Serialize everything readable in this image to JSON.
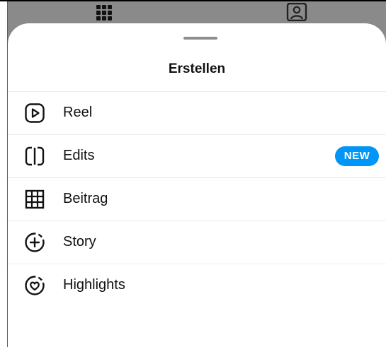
{
  "sheet": {
    "title": "Erstellen",
    "items": [
      {
        "label": "Reel",
        "icon": "reel-icon"
      },
      {
        "label": "Edits",
        "icon": "edits-icon",
        "badge": "NEW"
      },
      {
        "label": "Beitrag",
        "icon": "post-grid-icon"
      },
      {
        "label": "Story",
        "icon": "story-add-icon"
      },
      {
        "label": "Highlights",
        "icon": "highlights-heart-icon"
      }
    ]
  },
  "background": {
    "icons": [
      "grid-icon",
      "profile-icon"
    ]
  },
  "colors": {
    "badge": "#0095f6",
    "text": "#111111",
    "backdrop": "#8a8a8a"
  }
}
